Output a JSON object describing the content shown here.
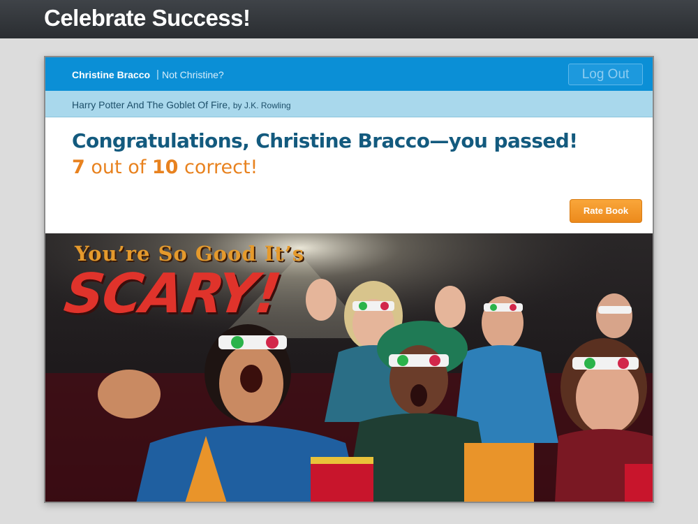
{
  "banner": {
    "title": "Celebrate Success!"
  },
  "user": {
    "name": "Christine Bracco",
    "separator": "|",
    "not_user": "Not Christine?",
    "logout_label": "Log Out"
  },
  "book": {
    "title": "Harry Potter And The Goblet Of Fire,",
    "author": "by J.K. Rowling"
  },
  "result": {
    "message": "Congratulations, Christine Bracco—you passed!",
    "correct": "7",
    "out_of_text": "out of",
    "total": "10",
    "correct_text": "correct!"
  },
  "actions": {
    "rate_label": "Rate Book"
  },
  "poster": {
    "headline": "You’re So Good It’s",
    "scary": "SCARY!"
  },
  "colors": {
    "header_blue": "#0b8fd6",
    "book_bar": "#a9d8ec",
    "accent_orange": "#e8821f",
    "title_blue": "#135a7e"
  }
}
